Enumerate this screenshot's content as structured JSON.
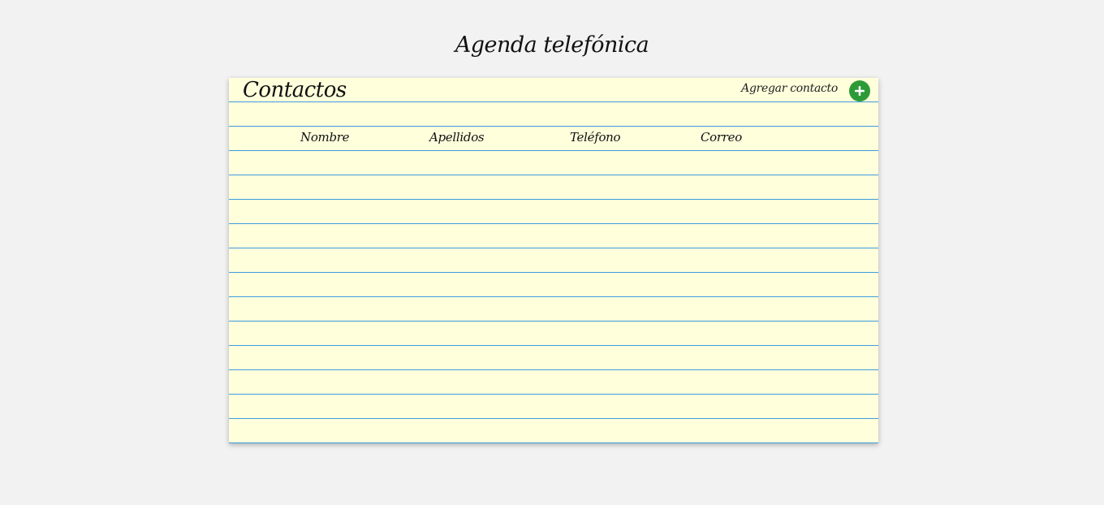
{
  "page": {
    "title": "Agenda telefónica"
  },
  "contacts_card": {
    "title": "Contactos",
    "add_label": "Agregar contacto",
    "add_icon": "plus-icon",
    "columns": [
      "Nombre",
      "Apellidos",
      "Teléfono",
      "Correo"
    ],
    "rows": []
  },
  "colors": {
    "background": "#f2f2f2",
    "paper": "#ffffdc",
    "rule_line": "#3d9be0",
    "add_button": "#2d9a37"
  }
}
